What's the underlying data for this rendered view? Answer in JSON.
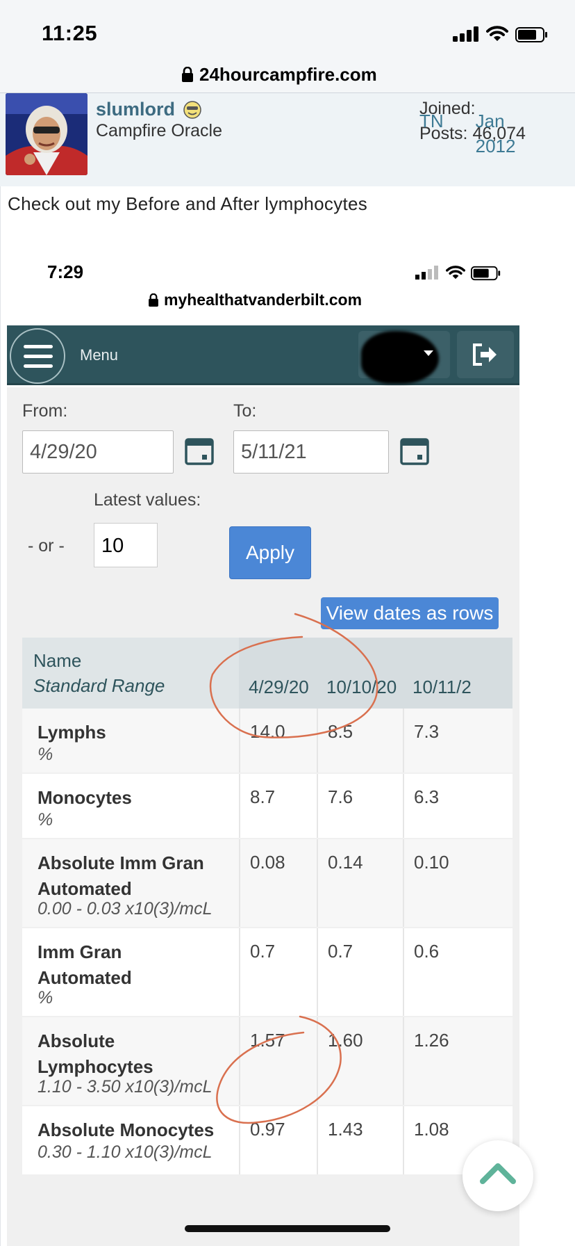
{
  "status": {
    "time": "11:25",
    "signal_icon": "cellular-signal-icon",
    "wifi_icon": "wifi-icon",
    "battery_icon": "battery-icon"
  },
  "browser": {
    "url": "24hourcampfire.com",
    "lock_icon": "lock-icon"
  },
  "post": {
    "username": "slumlord",
    "user_title": "Campfire Oracle",
    "joined_label": "Joined:",
    "joined_value": "Jan 2012",
    "posts_label": "Posts:",
    "posts_value": "46,074",
    "location": "TN",
    "text": "Check out my Before and After lymphocytes"
  },
  "embedded": {
    "time": "7:29",
    "url": "myhealthatvanderbilt.com",
    "menu_label": "Menu",
    "from_label": "From:",
    "from_value": "4/29/20",
    "to_label": "To:",
    "to_value": "5/11/21",
    "latest_label": "Latest values:",
    "or_label": "- or -",
    "latest_value": "10",
    "apply_label": "Apply",
    "view_rows_label": "View dates as rows",
    "table": {
      "name_header": "Name",
      "range_header": "Standard Range",
      "dates": [
        "4/29/20",
        "10/10/20",
        "10/11/2"
      ],
      "rows": [
        {
          "name": "Lymphs",
          "range": "%",
          "values": [
            "14.0",
            "8.5",
            "7.3"
          ]
        },
        {
          "name": "Monocytes",
          "range": "%",
          "values": [
            "8.7",
            "7.6",
            "6.3"
          ]
        },
        {
          "name": "Absolute Imm Gran Automated",
          "range": "0.00 - 0.03 x10(3)/mcL",
          "values": [
            "0.08",
            "0.14",
            "0.10"
          ]
        },
        {
          "name": "Imm Gran Automated",
          "range": "%",
          "values": [
            "0.7",
            "0.7",
            "0.6"
          ]
        },
        {
          "name": "Absolute Lymphocytes",
          "range": "1.10 - 3.50 x10(3)/mcL",
          "values": [
            "1.57",
            "1.60",
            "1.26"
          ]
        },
        {
          "name": "Absolute Monocytes",
          "range": "0.30 - 1.10 x10(3)/mcL",
          "values": [
            "0.97",
            "1.43",
            "1.08"
          ]
        }
      ]
    }
  },
  "colors": {
    "nav_teal": "#2e545c",
    "button_blue": "#4b87d6",
    "link_teal": "#3d7a94",
    "annotation_red": "#d9704f",
    "scroll_chevron": "#5fb39a"
  }
}
